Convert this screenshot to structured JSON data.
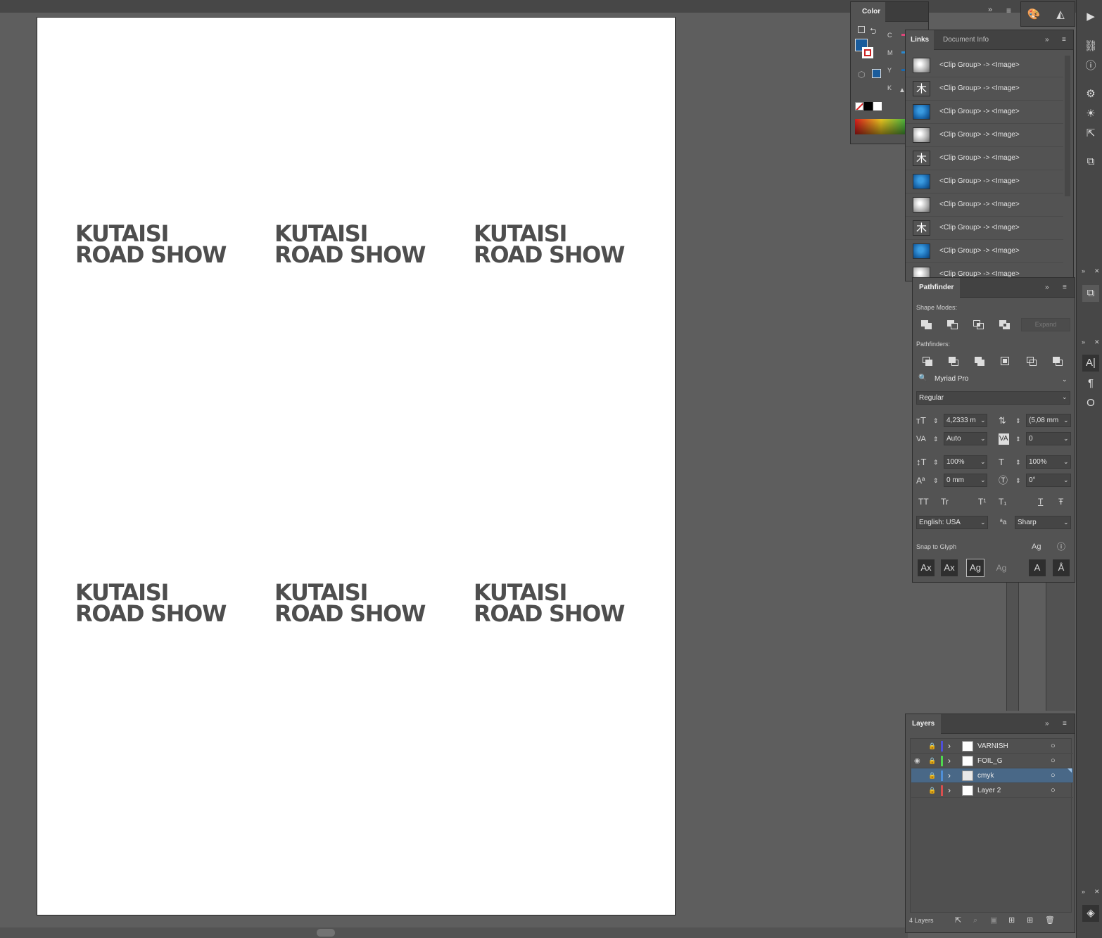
{
  "canvas": {
    "logo": {
      "line1": "KUTAISI",
      "line2": "ROAD SHOW"
    }
  },
  "color_panel": {
    "title": "Color",
    "channels": [
      "C",
      "M",
      "Y",
      "K"
    ],
    "fill_color": "#1a5c9c",
    "channel_colors": [
      "#e0457a",
      "#2a8ad0",
      "#1a6ab0",
      "#2d2d2d"
    ]
  },
  "links_panel": {
    "tabs": [
      "Links",
      "Document Info"
    ],
    "items": [
      {
        "thumb": "grey-sphere",
        "name": "<Clip Group> -> <Image>"
      },
      {
        "thumb": "tree",
        "name": "<Clip Group> -> <Image>"
      },
      {
        "thumb": "blue-sphere",
        "name": "<Clip Group> -> <Image>"
      },
      {
        "thumb": "grey-sphere",
        "name": "<Clip Group> -> <Image>"
      },
      {
        "thumb": "tree",
        "name": "<Clip Group> -> <Image>"
      },
      {
        "thumb": "blue-sphere",
        "name": "<Clip Group> -> <Image>"
      },
      {
        "thumb": "grey-sphere",
        "name": "<Clip Group> -> <Image>"
      },
      {
        "thumb": "tree",
        "name": "<Clip Group> -> <Image>"
      },
      {
        "thumb": "blue-sphere",
        "name": "<Clip Group> -> <Image>"
      },
      {
        "thumb": "grey-sphere",
        "name": "<Clip Group> -> <Image>"
      }
    ]
  },
  "pathfinder_panel": {
    "title": "Pathfinder",
    "shape_modes_label": "Shape Modes:",
    "expand_label": "Expand",
    "pathfinders_label": "Pathfinders:"
  },
  "character_panel": {
    "font_family": "Myriad Pro",
    "font_style": "Regular",
    "font_size": "4,2333 m",
    "leading": "(5,08 mm",
    "kerning": "Auto",
    "tracking": "0",
    "vertical_scale": "100%",
    "horizontal_scale": "100%",
    "baseline_shift": "0 mm",
    "rotation": "0°",
    "language": "English: USA",
    "antialias": "Sharp",
    "snap_label": "Snap to Glyph",
    "caps_icons": [
      "TT",
      "Tr",
      "T¹",
      "T₁",
      "T",
      "Ŧ"
    ]
  },
  "layers_panel": {
    "title": "Layers",
    "count_label": "4 Layers",
    "layers": [
      {
        "name": "VARNISH",
        "color": "#4f4fd8",
        "visible": false,
        "selected": false
      },
      {
        "name": "FOIL_G",
        "color": "#4fd84f",
        "visible": true,
        "selected": false
      },
      {
        "name": "cmyk",
        "color": "#4f8fd8",
        "visible": false,
        "selected": true
      },
      {
        "name": "Layer 2",
        "color": "#d84f4f",
        "visible": false,
        "selected": false
      }
    ]
  },
  "icons": {
    "collapse": "»",
    "menu": "≡",
    "lock": "🔒",
    "eye": "👁",
    "chevron": "›",
    "target": "○"
  }
}
